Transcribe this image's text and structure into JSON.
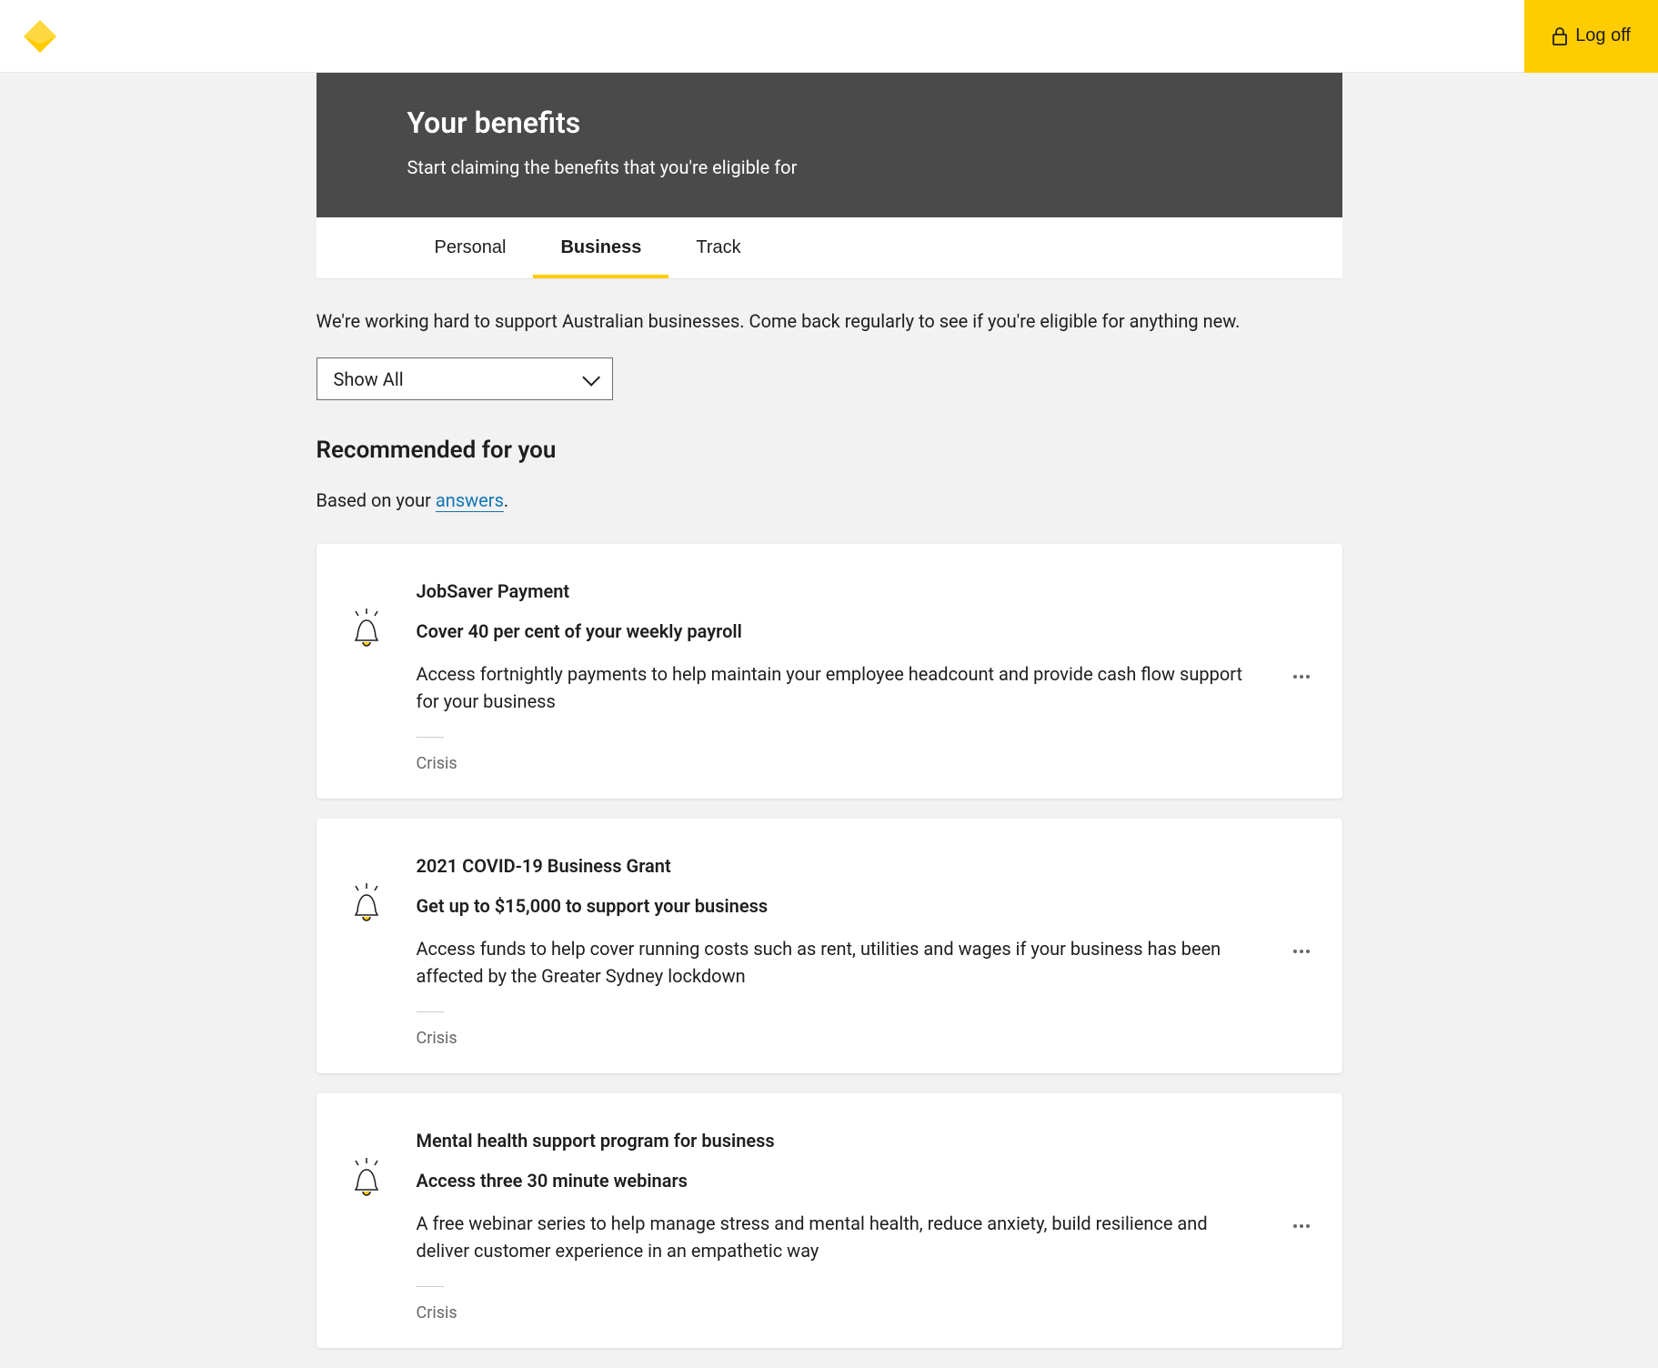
{
  "header": {
    "logoff_label": "Log off"
  },
  "hero": {
    "title": "Your benefits",
    "subtitle": "Start claiming the benefits that you're eligible for"
  },
  "tabs": {
    "items": [
      {
        "label": "Personal",
        "active": false
      },
      {
        "label": "Business",
        "active": true
      },
      {
        "label": "Track",
        "active": false
      }
    ]
  },
  "content": {
    "intro": "We're working hard to support Australian businesses. Come back regularly to see if you're eligible for anything new.",
    "filter_selected": "Show All",
    "section_title": "Recommended for you",
    "based_on_prefix": "Based on your ",
    "based_on_link": "answers",
    "based_on_suffix": "."
  },
  "cards": [
    {
      "title": "JobSaver Payment",
      "subtitle": "Cover 40 per cent of your weekly payroll",
      "description": "Access fortnightly payments to help maintain your employee headcount and provide cash flow support for your business",
      "tag": "Crisis"
    },
    {
      "title": "2021 COVID-19 Business Grant",
      "subtitle": "Get up to $15,000 to support your business",
      "description": "Access funds to help cover running costs such as rent, utilities and wages if your business has been affected by the Greater Sydney lockdown",
      "tag": "Crisis"
    },
    {
      "title": "Mental health support program for business",
      "subtitle": "Access three 30 minute webinars",
      "description": "A free webinar series to help manage stress and mental health, reduce anxiety, build resilience and deliver customer experience in an empathetic way",
      "tag": "Crisis"
    }
  ]
}
